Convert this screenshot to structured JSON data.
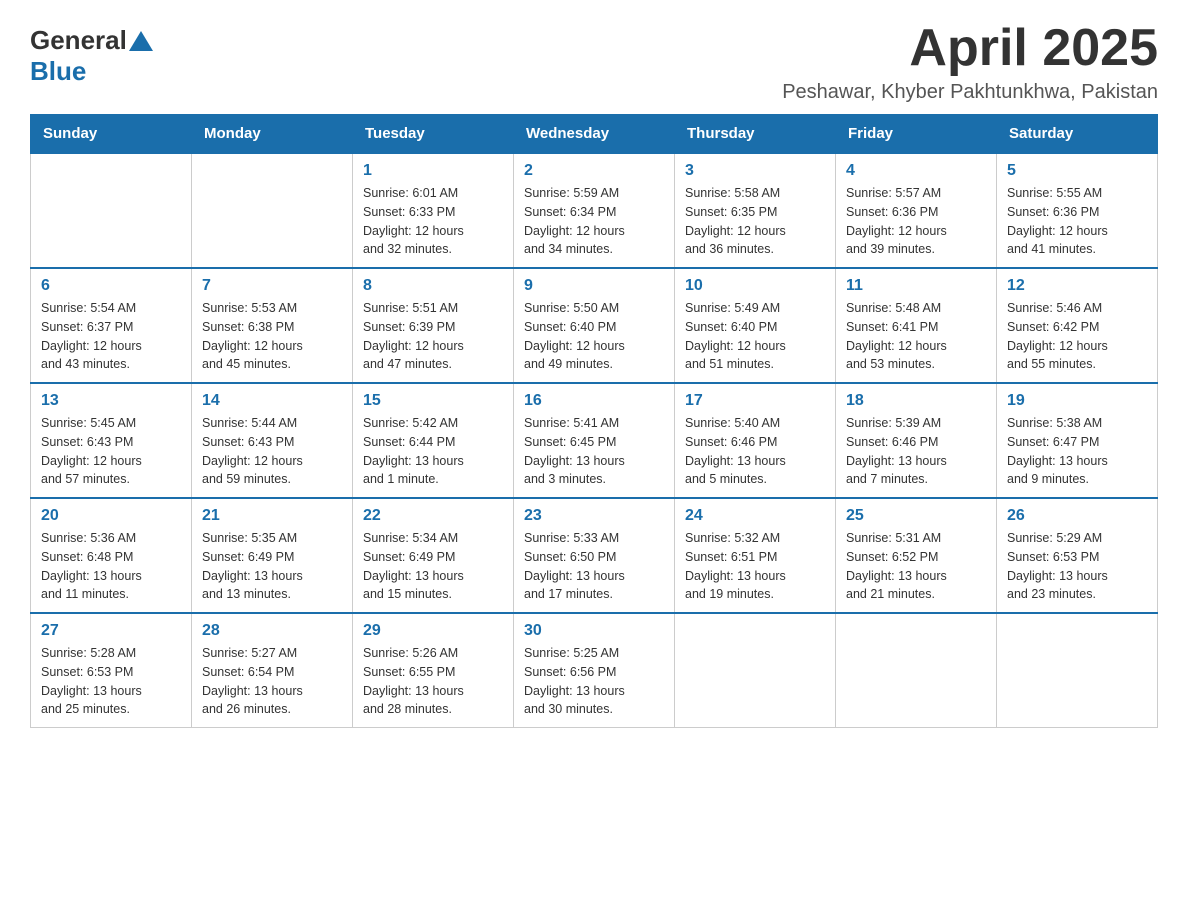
{
  "header": {
    "logo_general": "General",
    "logo_blue": "Blue",
    "title": "April 2025",
    "subtitle": "Peshawar, Khyber Pakhtunkhwa, Pakistan"
  },
  "days_of_week": [
    "Sunday",
    "Monday",
    "Tuesday",
    "Wednesday",
    "Thursday",
    "Friday",
    "Saturday"
  ],
  "weeks": [
    [
      {
        "day": "",
        "info": ""
      },
      {
        "day": "",
        "info": ""
      },
      {
        "day": "1",
        "info": "Sunrise: 6:01 AM\nSunset: 6:33 PM\nDaylight: 12 hours\nand 32 minutes."
      },
      {
        "day": "2",
        "info": "Sunrise: 5:59 AM\nSunset: 6:34 PM\nDaylight: 12 hours\nand 34 minutes."
      },
      {
        "day": "3",
        "info": "Sunrise: 5:58 AM\nSunset: 6:35 PM\nDaylight: 12 hours\nand 36 minutes."
      },
      {
        "day": "4",
        "info": "Sunrise: 5:57 AM\nSunset: 6:36 PM\nDaylight: 12 hours\nand 39 minutes."
      },
      {
        "day": "5",
        "info": "Sunrise: 5:55 AM\nSunset: 6:36 PM\nDaylight: 12 hours\nand 41 minutes."
      }
    ],
    [
      {
        "day": "6",
        "info": "Sunrise: 5:54 AM\nSunset: 6:37 PM\nDaylight: 12 hours\nand 43 minutes."
      },
      {
        "day": "7",
        "info": "Sunrise: 5:53 AM\nSunset: 6:38 PM\nDaylight: 12 hours\nand 45 minutes."
      },
      {
        "day": "8",
        "info": "Sunrise: 5:51 AM\nSunset: 6:39 PM\nDaylight: 12 hours\nand 47 minutes."
      },
      {
        "day": "9",
        "info": "Sunrise: 5:50 AM\nSunset: 6:40 PM\nDaylight: 12 hours\nand 49 minutes."
      },
      {
        "day": "10",
        "info": "Sunrise: 5:49 AM\nSunset: 6:40 PM\nDaylight: 12 hours\nand 51 minutes."
      },
      {
        "day": "11",
        "info": "Sunrise: 5:48 AM\nSunset: 6:41 PM\nDaylight: 12 hours\nand 53 minutes."
      },
      {
        "day": "12",
        "info": "Sunrise: 5:46 AM\nSunset: 6:42 PM\nDaylight: 12 hours\nand 55 minutes."
      }
    ],
    [
      {
        "day": "13",
        "info": "Sunrise: 5:45 AM\nSunset: 6:43 PM\nDaylight: 12 hours\nand 57 minutes."
      },
      {
        "day": "14",
        "info": "Sunrise: 5:44 AM\nSunset: 6:43 PM\nDaylight: 12 hours\nand 59 minutes."
      },
      {
        "day": "15",
        "info": "Sunrise: 5:42 AM\nSunset: 6:44 PM\nDaylight: 13 hours\nand 1 minute."
      },
      {
        "day": "16",
        "info": "Sunrise: 5:41 AM\nSunset: 6:45 PM\nDaylight: 13 hours\nand 3 minutes."
      },
      {
        "day": "17",
        "info": "Sunrise: 5:40 AM\nSunset: 6:46 PM\nDaylight: 13 hours\nand 5 minutes."
      },
      {
        "day": "18",
        "info": "Sunrise: 5:39 AM\nSunset: 6:46 PM\nDaylight: 13 hours\nand 7 minutes."
      },
      {
        "day": "19",
        "info": "Sunrise: 5:38 AM\nSunset: 6:47 PM\nDaylight: 13 hours\nand 9 minutes."
      }
    ],
    [
      {
        "day": "20",
        "info": "Sunrise: 5:36 AM\nSunset: 6:48 PM\nDaylight: 13 hours\nand 11 minutes."
      },
      {
        "day": "21",
        "info": "Sunrise: 5:35 AM\nSunset: 6:49 PM\nDaylight: 13 hours\nand 13 minutes."
      },
      {
        "day": "22",
        "info": "Sunrise: 5:34 AM\nSunset: 6:49 PM\nDaylight: 13 hours\nand 15 minutes."
      },
      {
        "day": "23",
        "info": "Sunrise: 5:33 AM\nSunset: 6:50 PM\nDaylight: 13 hours\nand 17 minutes."
      },
      {
        "day": "24",
        "info": "Sunrise: 5:32 AM\nSunset: 6:51 PM\nDaylight: 13 hours\nand 19 minutes."
      },
      {
        "day": "25",
        "info": "Sunrise: 5:31 AM\nSunset: 6:52 PM\nDaylight: 13 hours\nand 21 minutes."
      },
      {
        "day": "26",
        "info": "Sunrise: 5:29 AM\nSunset: 6:53 PM\nDaylight: 13 hours\nand 23 minutes."
      }
    ],
    [
      {
        "day": "27",
        "info": "Sunrise: 5:28 AM\nSunset: 6:53 PM\nDaylight: 13 hours\nand 25 minutes."
      },
      {
        "day": "28",
        "info": "Sunrise: 5:27 AM\nSunset: 6:54 PM\nDaylight: 13 hours\nand 26 minutes."
      },
      {
        "day": "29",
        "info": "Sunrise: 5:26 AM\nSunset: 6:55 PM\nDaylight: 13 hours\nand 28 minutes."
      },
      {
        "day": "30",
        "info": "Sunrise: 5:25 AM\nSunset: 6:56 PM\nDaylight: 13 hours\nand 30 minutes."
      },
      {
        "day": "",
        "info": ""
      },
      {
        "day": "",
        "info": ""
      },
      {
        "day": "",
        "info": ""
      }
    ]
  ]
}
